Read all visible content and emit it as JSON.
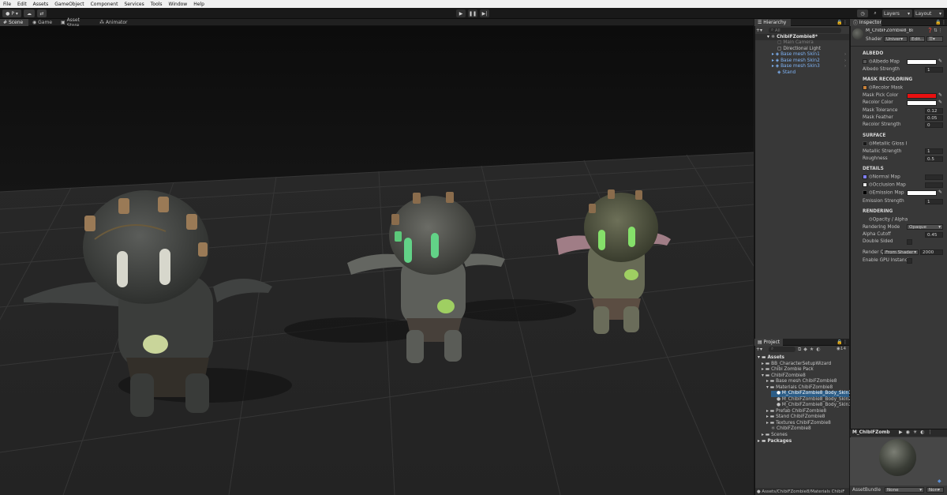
{
  "menu": [
    "File",
    "Edit",
    "Assets",
    "GameObject",
    "Component",
    "Services",
    "Tools",
    "Window",
    "Help"
  ],
  "toolbar": {
    "account": "P ▾",
    "layers": "Layers",
    "layout": "Layout"
  },
  "tabs": {
    "scene": "Scene",
    "game": "Game",
    "asset_store": "Asset Store",
    "animator": "Animator"
  },
  "hierarchy": {
    "title": "Hierarchy",
    "search_placeholder": "All",
    "items": [
      {
        "label": "ChibiFZombie8*"
      },
      {
        "label": "Main Camera"
      },
      {
        "label": "Directional Light"
      },
      {
        "label": "Base mesh Skin1"
      },
      {
        "label": "Base mesh Skin2"
      },
      {
        "label": "Base mesh Skin3"
      },
      {
        "label": "Stand"
      }
    ]
  },
  "inspector": {
    "title": "Inspector",
    "object_name": "M_ChibiFZombie8_Body_",
    "shader_label": "Shader",
    "shader_value": "Univer▾",
    "edit_button": "Edit...",
    "albedo": {
      "header": "ALBEDO",
      "map": "Albedo Map",
      "strength_label": "Albedo Strength",
      "strength": "1"
    },
    "mask": {
      "header": "MASK RECOLORING",
      "recolor_mask": "Recolor Mask",
      "pick_color": "Mask Pick Color",
      "recolor_color": "Recolor Color",
      "tolerance_label": "Mask Tolerance",
      "tolerance": "0.12",
      "feather_label": "Mask Feather",
      "feather": "0.05",
      "strength_label": "Recolor Strength",
      "strength": "0"
    },
    "surface": {
      "header": "SURFACE",
      "gloss": "Metallic Gloss I",
      "metallic_label": "Metallic Strength",
      "metallic": "1",
      "roughness_label": "Roughness",
      "roughness": "0.5"
    },
    "details": {
      "header": "DETAILS",
      "normal": "Normal Map",
      "occlusion": "Occlusion Map",
      "emission": "Emission Map",
      "emission_strength_label": "Emission Strength",
      "emission_strength": "1"
    },
    "rendering": {
      "header": "RENDERING",
      "opacity": "Opacity / Alpha",
      "mode_label": "Rendering Mode",
      "mode": "Opaque",
      "cutoff_label": "Alpha Cutoff",
      "cutoff": "0.45",
      "double_sided": "Double Sided",
      "queue_label": "Render Q",
      "queue_mode": "From Shader",
      "queue_value": "2000",
      "gpu": "Enable GPU Instanci"
    },
    "preview_name": "M_ChibiFZomb",
    "assetbundle_label": "AssetBundle",
    "assetbundle_value": "None",
    "assetbundle_variant": "Non▾"
  },
  "project": {
    "title": "Project",
    "count": "14",
    "items": [
      {
        "label": "Assets"
      },
      {
        "label": "BB_CharacterSetupWizard"
      },
      {
        "label": "Chibi Zombie Pack"
      },
      {
        "label": "ChibiFZombie8"
      },
      {
        "label": "Base mesh ChibiFZombie8"
      },
      {
        "label": "Materials ChibiFZombie8"
      },
      {
        "label": "M_ChibiFZombie8_Body_Skin1"
      },
      {
        "label": "M_ChibiFZombie8_Body_Skin2"
      },
      {
        "label": "M_ChibiFZombie8_Body_Skin3"
      },
      {
        "label": "Prefab ChibiFZombie8"
      },
      {
        "label": "Stand ChibiFZombie8"
      },
      {
        "label": "Textures ChibiFZombie8"
      },
      {
        "label": "ChibiFZombie8"
      },
      {
        "label": "Scenes"
      },
      {
        "label": "Packages"
      }
    ],
    "path": "Assets/ChibiFZombie8/Materials ChibiF"
  },
  "colors": {
    "mask_pick": "#e81010",
    "white": "#ffffff",
    "accent": "#2c5d87",
    "panel": "#383838"
  }
}
